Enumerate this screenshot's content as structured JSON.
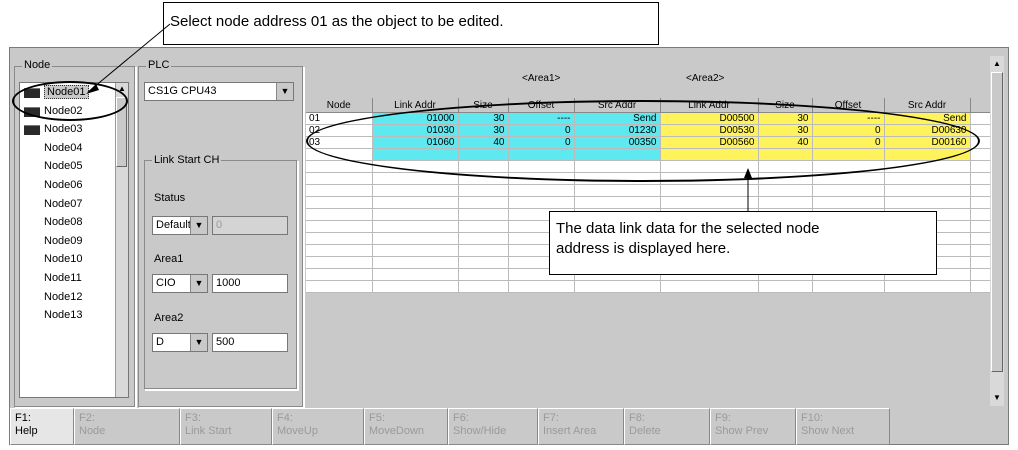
{
  "callouts": {
    "top": "Select node address 01 as the object to be edited.",
    "middle_line1": "The data link data for the selected node",
    "middle_line2": "address is displayed here."
  },
  "node_panel": {
    "label": "Node",
    "items": [
      "Node01",
      "Node02",
      "Node03",
      "Node04",
      "Node05",
      "Node06",
      "Node07",
      "Node08",
      "Node09",
      "Node10",
      "Node11",
      "Node12",
      "Node13"
    ],
    "selected": "Node01"
  },
  "plc_panel": {
    "label": "PLC",
    "plc_model": "CS1G CPU43",
    "link_start_label": "Link Start CH",
    "status_label": "Status",
    "status_value": "Default",
    "status_field": "0",
    "area1_label": "Area1",
    "area1_type": "CIO",
    "area1_value": "1000",
    "area2_label": "Area2",
    "area2_type": "D",
    "area2_value": "500"
  },
  "grid": {
    "area1_header": "<Area1>",
    "area2_header": "<Area2>",
    "columns": [
      "Node",
      "Link Addr",
      "Size",
      "Offset",
      "Src Addr",
      "Link Addr",
      "Size",
      "Offset",
      "Src Addr"
    ],
    "rows": [
      [
        "01",
        "01000",
        "30",
        "----",
        "Send",
        "D00500",
        "30",
        "----",
        "Send"
      ],
      [
        "02",
        "01030",
        "30",
        "0",
        "01230",
        "D00530",
        "30",
        "0",
        "D00630"
      ],
      [
        "03",
        "01060",
        "40",
        "0",
        "00350",
        "D00560",
        "40",
        "0",
        "D00160"
      ]
    ]
  },
  "fkeys": [
    {
      "key": "F1:",
      "label": "Help"
    },
    {
      "key": "F2:",
      "label": "Node"
    },
    {
      "key": "F3:",
      "label": "Link Start"
    },
    {
      "key": "F4:",
      "label": "MoveUp"
    },
    {
      "key": "F5:",
      "label": "MoveDown"
    },
    {
      "key": "F6:",
      "label": "Show/Hide"
    },
    {
      "key": "F7:",
      "label": "Insert Area"
    },
    {
      "key": "F8:",
      "label": "Delete"
    },
    {
      "key": "F9:",
      "label": "Show Prev"
    },
    {
      "key": "F10:",
      "label": "Show Next"
    }
  ],
  "colors": {
    "area1_fill": "#5ee8ef",
    "area2_fill": "#fff35c",
    "window_bg": "#c9c9c9"
  }
}
